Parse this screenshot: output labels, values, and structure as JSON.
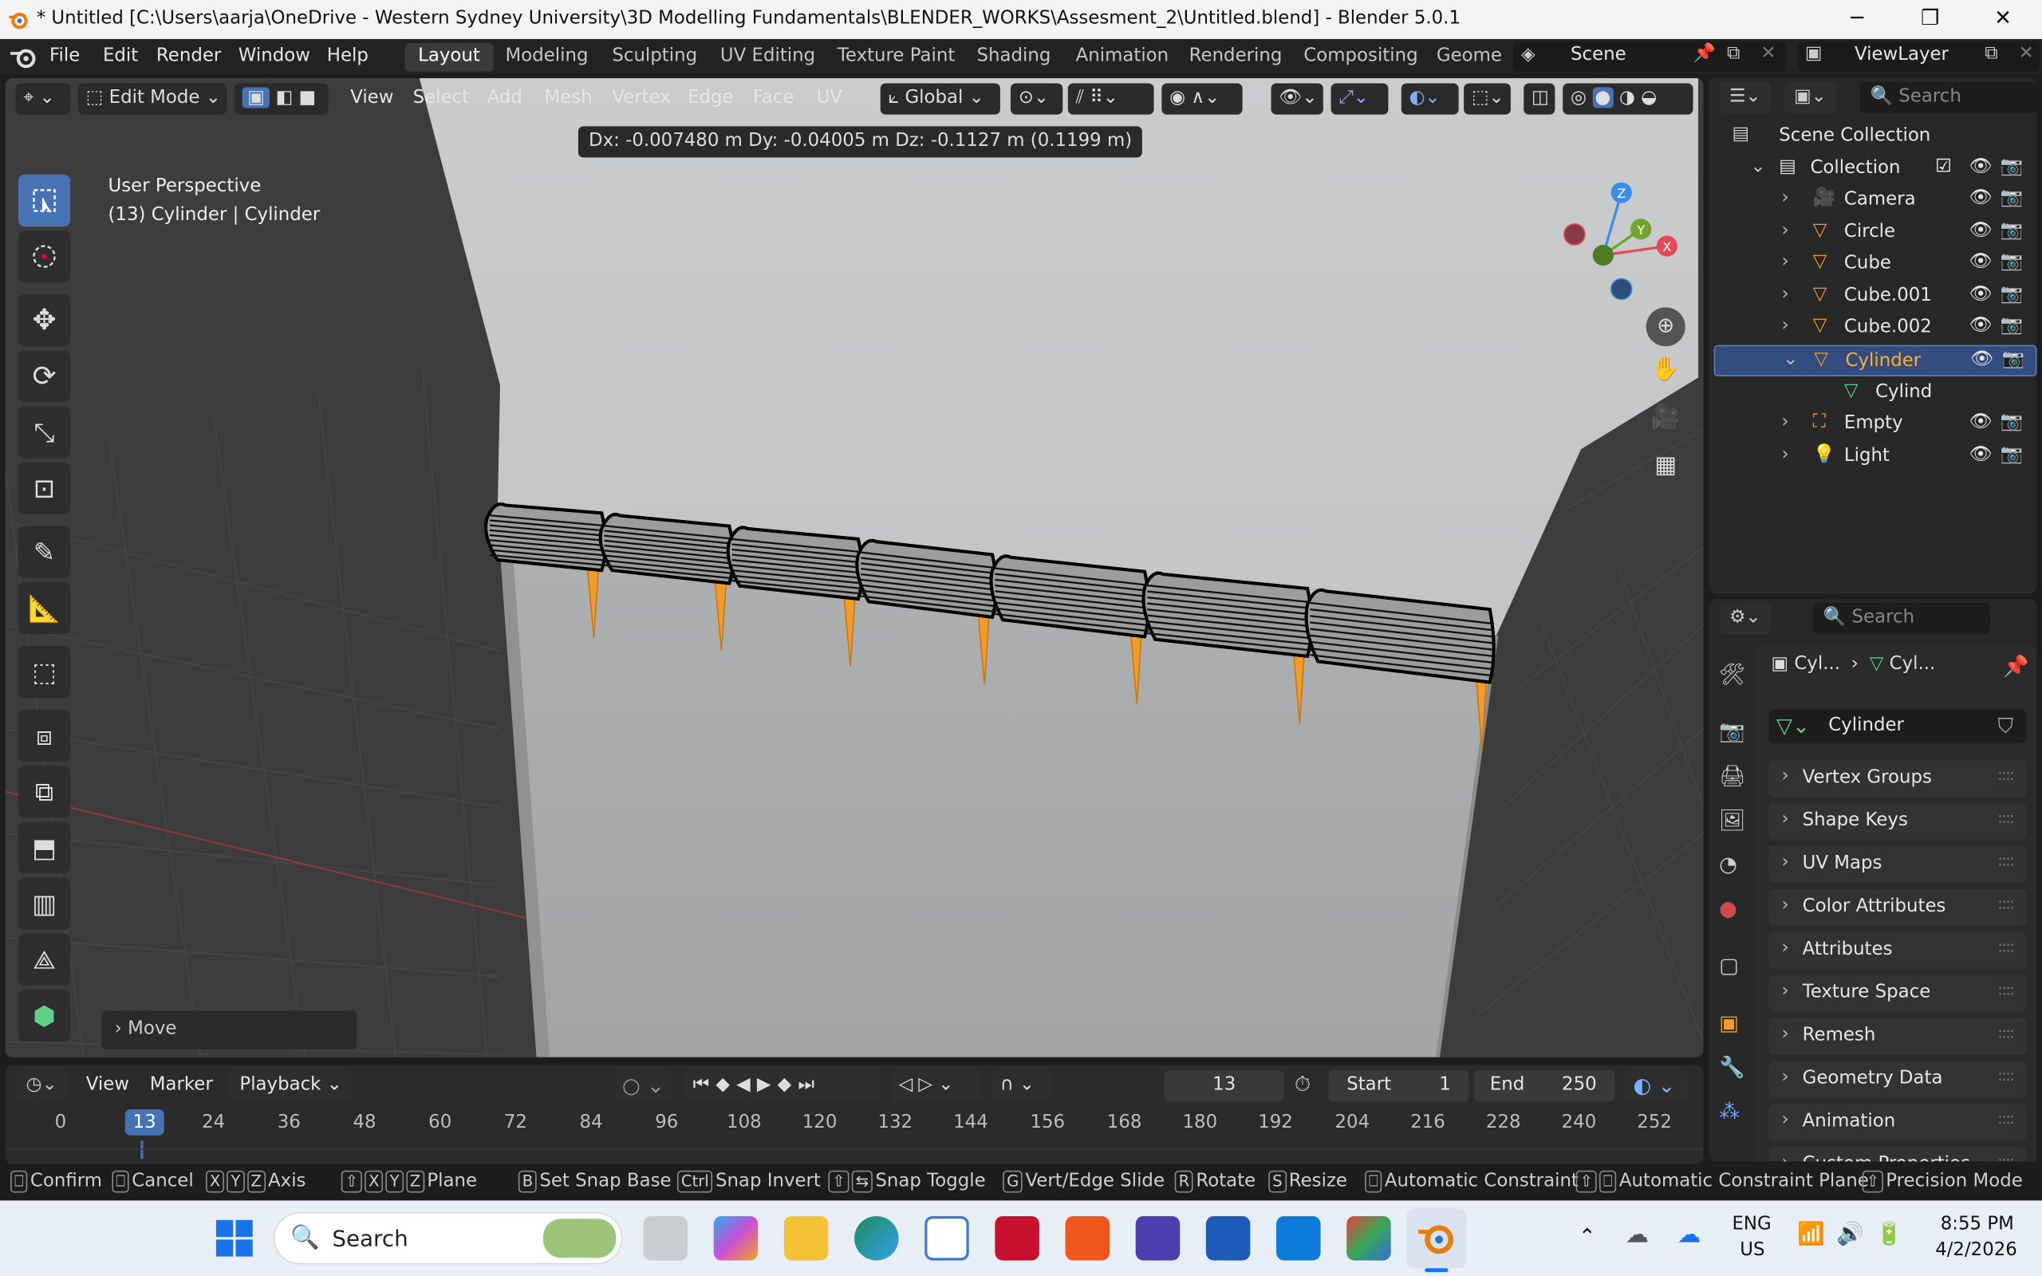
{
  "window": {
    "title": "* Untitled [C:\\Users\\aarja\\OneDrive - Western Sydney University\\3D Modelling Fundamentals\\BLENDER_WORKS\\Assesment_2\\Untitled.blend] - Blender 5.0.1",
    "minimize": "─",
    "maximize": "❐",
    "close": "✕"
  },
  "menubar": {
    "items": [
      "File",
      "Edit",
      "Render",
      "Window",
      "Help"
    ],
    "workspaces": [
      "Layout",
      "Modeling",
      "Sculpting",
      "UV Editing",
      "Texture Paint",
      "Shading",
      "Animation",
      "Rendering",
      "Compositing",
      "Geome"
    ],
    "scene": "Scene",
    "view_layer": "ViewLayer"
  },
  "viewport_header": {
    "mode": "Edit Mode",
    "menus": [
      "View",
      "Select",
      "Add",
      "Mesh",
      "Vertex",
      "Edge",
      "Face",
      "UV"
    ],
    "transform_orientation": "Global"
  },
  "viewport": {
    "readout": "Dx: -0.007480 m   Dy: -0.04005 m   Dz: -0.1127 m (0.1199 m)",
    "perspective": "User Perspective",
    "object_info": "(13) Cylinder | Cylinder",
    "last_op": "Move",
    "gizmo": {
      "z": "Z",
      "y": "Y",
      "x": "X"
    }
  },
  "outliner": {
    "search_placeholder": "Search",
    "root": "Scene Collection",
    "collection": "Collection",
    "items": [
      {
        "name": "Camera",
        "type": "camera"
      },
      {
        "name": "Circle",
        "type": "mesh"
      },
      {
        "name": "Cube",
        "type": "mesh"
      },
      {
        "name": "Cube.001",
        "type": "mesh"
      },
      {
        "name": "Cube.002",
        "type": "mesh"
      },
      {
        "name": "Cylinder",
        "type": "mesh",
        "selected": true
      },
      {
        "name": "Cylind",
        "type": "meshdata",
        "child": true
      },
      {
        "name": "Empty",
        "type": "empty"
      },
      {
        "name": "Light",
        "type": "light"
      }
    ]
  },
  "properties": {
    "search_placeholder": "Search",
    "breadcrumb": [
      "Cyl...",
      "Cyl..."
    ],
    "datablock": "Cylinder",
    "sections": [
      "Vertex Groups",
      "Shape Keys",
      "UV Maps",
      "Color Attributes",
      "Attributes",
      "Texture Space",
      "Remesh",
      "Geometry Data",
      "Animation",
      "Custom Properties"
    ]
  },
  "timeline": {
    "menus": [
      "View",
      "Marker",
      "Playback"
    ],
    "current_frame": "13",
    "start_label": "Start",
    "start": "1",
    "end_label": "End",
    "end": "250",
    "ticks": [
      "0",
      "13",
      "24",
      "36",
      "48",
      "60",
      "72",
      "84",
      "96",
      "108",
      "120",
      "132",
      "144",
      "156",
      "168",
      "180",
      "192",
      "204",
      "216",
      "228",
      "240",
      "252"
    ]
  },
  "statusbar": [
    {
      "keys": [
        "⎕"
      ],
      "label": "Confirm"
    },
    {
      "keys": [
        "⎕"
      ],
      "label": "Cancel"
    },
    {
      "keys": [
        "X",
        "Y",
        "Z"
      ],
      "label": "Axis"
    },
    {
      "keys": [
        "⇧",
        "X",
        "Y",
        "Z"
      ],
      "label": "Plane"
    },
    {
      "keys": [
        "B"
      ],
      "label": "Set Snap Base"
    },
    {
      "keys": [
        "Ctrl"
      ],
      "label": "Snap Invert"
    },
    {
      "keys": [
        "⇧",
        "⇆"
      ],
      "label": "Snap Toggle"
    },
    {
      "keys": [
        "G"
      ],
      "label": "Vert/Edge Slide"
    },
    {
      "keys": [
        "R"
      ],
      "label": "Rotate"
    },
    {
      "keys": [
        "S"
      ],
      "label": "Resize"
    },
    {
      "keys": [
        "⎕"
      ],
      "label": "Automatic Constraint"
    },
    {
      "keys": [
        "⇧",
        "⎕"
      ],
      "label": "Automatic Constraint Plane"
    },
    {
      "keys": [
        "⇧"
      ],
      "label": "Precision Mode"
    }
  ],
  "taskbar": {
    "search": "Search",
    "lang1": "ENG",
    "lang2": "US",
    "time": "8:55 PM",
    "date": "4/2/2026"
  },
  "colors": {
    "accent": "#4772b3",
    "orange": "#f29a2a",
    "axis_x": "#e24a5a",
    "axis_y": "#6fa52c",
    "axis_z": "#3a8ee6"
  }
}
